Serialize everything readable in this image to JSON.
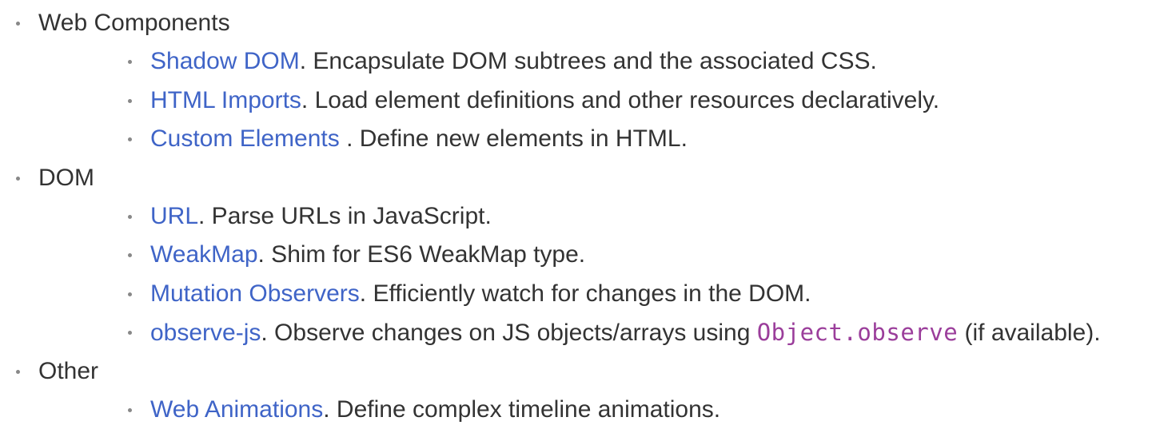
{
  "sections": [
    {
      "title": "Web Components",
      "items": [
        {
          "link": "Shadow DOM",
          "text": ". Encapsulate DOM subtrees and the associated CSS."
        },
        {
          "link": "HTML Imports",
          "text": ". Load element definitions and other resources declaratively."
        },
        {
          "link": "Custom Elements ",
          "text": ". Define new elements in HTML."
        }
      ]
    },
    {
      "title": "DOM",
      "items": [
        {
          "link": "URL",
          "text": ". Parse URLs in JavaScript."
        },
        {
          "link": "WeakMap",
          "text": ". Shim for ES6 WeakMap type."
        },
        {
          "link": "Mutation Observers",
          "text": ". Efficiently watch for changes in the DOM."
        },
        {
          "link": "observe-js",
          "text": ". Observe changes on JS objects/arrays using ",
          "code": "Object.observe",
          "text_after": " (if available)."
        }
      ]
    },
    {
      "title": "Other",
      "items": [
        {
          "link": "Web Animations",
          "text": ". Define complex timeline animations."
        }
      ]
    }
  ],
  "colors": {
    "link": "#3f64c7",
    "text": "#333333",
    "code": "#9b3e9b",
    "bullet": "#888888"
  }
}
